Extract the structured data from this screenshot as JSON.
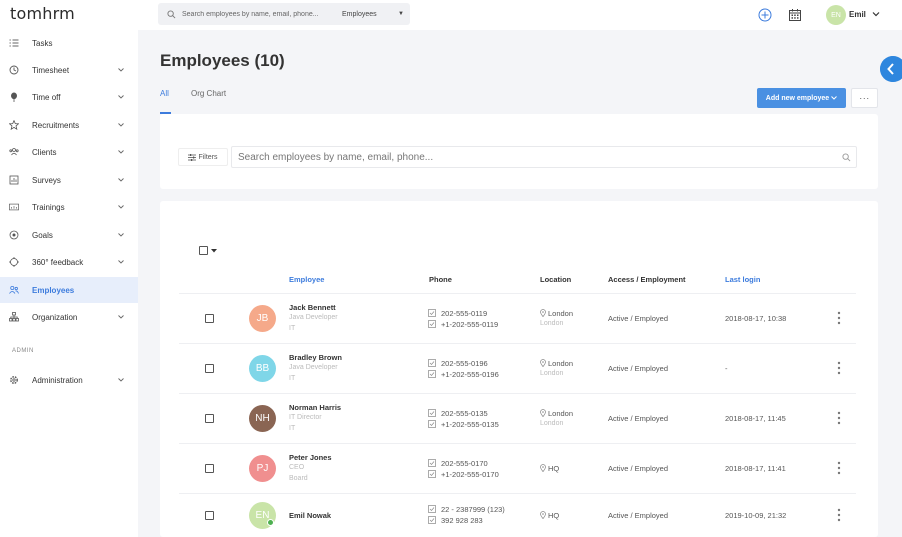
{
  "app": {
    "logo": "tomhrm"
  },
  "topbar": {
    "search_placeholder": "Search employees by name, email, phone...",
    "search_scope": "Employees",
    "user_initials": "EN",
    "user_name": "Emil"
  },
  "sidebar": {
    "items": [
      {
        "label": "Tasks",
        "icon": "tasks-icon",
        "has_chevron": false
      },
      {
        "label": "Timesheet",
        "icon": "clock-icon",
        "has_chevron": true
      },
      {
        "label": "Time off",
        "icon": "balloon-icon",
        "has_chevron": true
      },
      {
        "label": "Recruitments",
        "icon": "star-icon",
        "has_chevron": true
      },
      {
        "label": "Clients",
        "icon": "people-icon",
        "has_chevron": true
      },
      {
        "label": "Surveys",
        "icon": "survey-icon",
        "has_chevron": true
      },
      {
        "label": "Trainings",
        "icon": "training-icon",
        "has_chevron": true
      },
      {
        "label": "Goals",
        "icon": "target-icon",
        "has_chevron": true
      },
      {
        "label": "360° feedback",
        "icon": "feedback-icon",
        "has_chevron": true
      },
      {
        "label": "Employees",
        "icon": "employees-icon",
        "has_chevron": false,
        "active": true
      },
      {
        "label": "Organization",
        "icon": "org-chart-icon",
        "has_chevron": true
      }
    ],
    "admin_label": "ADMIN",
    "admin_items": [
      {
        "label": "Administration",
        "icon": "gear-icon",
        "has_chevron": true
      }
    ]
  },
  "page": {
    "title": "Employees (10)",
    "tabs": [
      {
        "label": "All",
        "active": true
      },
      {
        "label": "Org Chart",
        "active": false
      }
    ],
    "add_button": "Add new employee",
    "more_button": "···"
  },
  "filters": {
    "button_label": "Filters",
    "search_placeholder": "Search employees by name, email, phone..."
  },
  "table": {
    "columns": {
      "employee": "Employee",
      "phone": "Phone",
      "location": "Location",
      "access": "Access / Employment",
      "last_login": "Last login"
    },
    "rows": [
      {
        "initials": "JB",
        "avatar_color": "#f5a98a",
        "name": "Jack Bennett",
        "title": "Java Developer",
        "department": "IT",
        "phones": [
          "202-555-0119",
          "+1-202-555-0119"
        ],
        "location": "London",
        "location_secondary": "London",
        "access": "Active / Employed",
        "last_login": "2018-08-17, 10:38",
        "online": false
      },
      {
        "initials": "BB",
        "avatar_color": "#7fd6e8",
        "name": "Bradley Brown",
        "title": "Java Developer",
        "department": "IT",
        "phones": [
          "202-555-0196",
          "+1-202-555-0196"
        ],
        "location": "London",
        "location_secondary": "London",
        "access": "Active / Employed",
        "last_login": "-",
        "online": false
      },
      {
        "initials": "NH",
        "avatar_color": "#8a6553",
        "name": "Norman Harris",
        "title": "IT Director",
        "department": "IT",
        "phones": [
          "202-555-0135",
          "+1-202-555-0135"
        ],
        "location": "London",
        "location_secondary": "London",
        "access": "Active / Employed",
        "last_login": "2018-08-17, 11:45",
        "online": false
      },
      {
        "initials": "PJ",
        "avatar_color": "#f08f8f",
        "name": "Peter Jones",
        "title": "CEO",
        "department": "Board",
        "phones": [
          "202-555-0170",
          "+1-202-555-0170"
        ],
        "location": "HQ",
        "location_secondary": "",
        "access": "Active / Employed",
        "last_login": "2018-08-17, 11:41",
        "online": false
      },
      {
        "initials": "EN",
        "avatar_color": "#c9e4a8",
        "name": "Emil Nowak",
        "title": "",
        "department": "",
        "phones": [
          "22 - 2387999 (123)",
          "392 928 283"
        ],
        "location": "HQ",
        "location_secondary": "",
        "access": "Active / Employed",
        "last_login": "2019-10-09, 21:32",
        "online": true
      }
    ]
  },
  "colors": {
    "accent": "#3d7cdd",
    "button": "#4a90e2",
    "active_nav_bg": "#e7eefb",
    "online": "#4caf50"
  }
}
